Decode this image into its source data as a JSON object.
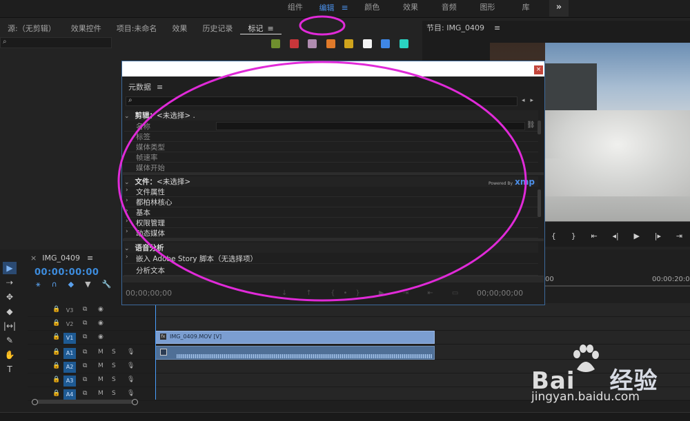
{
  "workspace_tabs": [
    {
      "label": "组件",
      "active": false
    },
    {
      "label": "编辑",
      "active": true,
      "menu_icon": "≡"
    },
    {
      "label": "颜色",
      "active": false
    },
    {
      "label": "效果",
      "active": false
    },
    {
      "label": "音频",
      "active": false
    },
    {
      "label": "图形",
      "active": false
    },
    {
      "label": "库",
      "active": false
    }
  ],
  "workspace_more": "»",
  "source_panel": {
    "tabs": [
      {
        "label": "源:（无剪辑）"
      },
      {
        "label": "效果控件"
      },
      {
        "label": "项目:未命名"
      },
      {
        "label": "效果"
      },
      {
        "label": "历史记录"
      },
      {
        "label": "标记",
        "active": true,
        "menu_icon": "≡"
      }
    ],
    "search_icon": "⌕",
    "marker_colors": [
      "#6f8f2e",
      "#c8363a",
      "#b08cb0",
      "#e07a2a",
      "#d0a41c",
      "#f4f4f4",
      "#3f87e6",
      "#2ad3c2"
    ]
  },
  "program_panel": {
    "title": "节目: IMG_0409",
    "menu_icon": "≡",
    "controls": [
      "{",
      "}",
      "⇤",
      "◂|",
      "▶",
      "|▸",
      "⇥"
    ]
  },
  "timeline": {
    "tab_close": "×",
    "tab_label": "IMG_0409",
    "menu_icon": "≡",
    "timecode": "00:00:00:00",
    "ruler_labels": [
      "00",
      "00:00:20:00"
    ],
    "icons": [
      "⚹",
      "∩",
      "◆",
      "▼",
      "🔧"
    ],
    "tracks": [
      {
        "name": "V3",
        "type": "video",
        "on": false
      },
      {
        "name": "V2",
        "type": "video",
        "on": false
      },
      {
        "name": "V1",
        "type": "video",
        "on": true
      },
      {
        "name": "A1",
        "type": "audio",
        "on": true
      },
      {
        "name": "A2",
        "type": "audio",
        "on": true
      },
      {
        "name": "A3",
        "type": "audio",
        "on": true
      },
      {
        "name": "A4",
        "type": "audio",
        "on": true
      }
    ],
    "audio_mute_label": "M",
    "audio_solo_label": "S",
    "video_clip_label": "IMG_0409.MOV [V]",
    "clip_fx_label": "fx"
  },
  "tools": [
    "▶",
    "⇢",
    "✥",
    "◆",
    "|↔|",
    "✎",
    "✋",
    "T"
  ],
  "metadata_dialog": {
    "close_label": "×",
    "title": "元数据",
    "menu_icon": "≡",
    "search_icon": "⌕",
    "nav_prev": "◂",
    "nav_next": "▸",
    "clip_section": {
      "label": "剪辑：",
      "value": "<未选择>",
      "suffix": "."
    },
    "clip_props": [
      "名称",
      "标签",
      "媒体类型",
      "帧速率",
      "媒体开始"
    ],
    "file_section": {
      "label": "文件：",
      "value": "<未选择>"
    },
    "file_groups": [
      "文件属性",
      "都柏林核心",
      "基本",
      "权限管理",
      "动态媒体"
    ],
    "speech_section": {
      "label": "语音分析"
    },
    "embed_row": "嵌入 Adobe Story 脚本（无选择项）",
    "analyze_row": "分析文本",
    "powered_by": "Powered By",
    "xmp_logo": "xmp",
    "footer_tc_left": "00;00;00;00",
    "footer_tc_right": "00;00;00;00",
    "footer_icons": "↓ ↑ {•} ▶ ⇥ ⇤ ▭"
  },
  "annotation_color": "#e02ad8",
  "watermark": {
    "brand": "Bai",
    "brand_suffix": "经验",
    "url": "jingyan.baidu.com"
  }
}
